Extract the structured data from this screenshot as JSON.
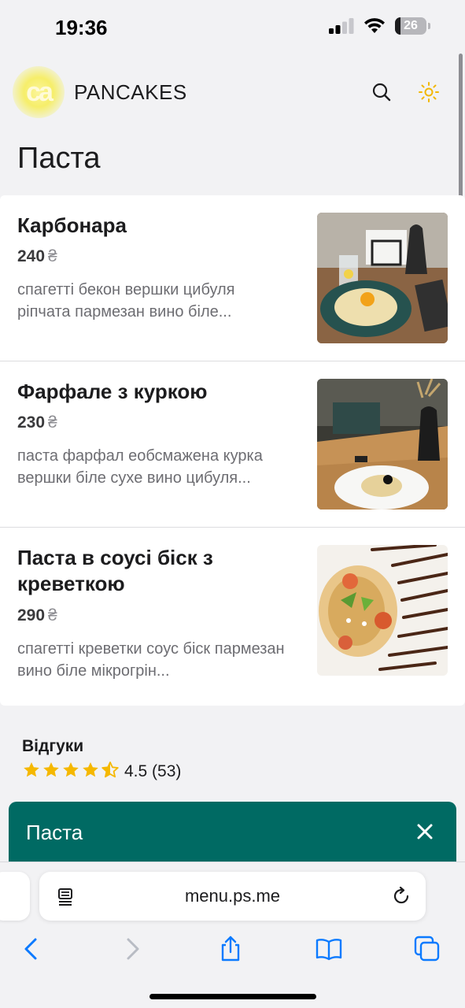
{
  "status_bar": {
    "time": "19:36",
    "battery_level": "26"
  },
  "header": {
    "logo_text": "ca",
    "brand_name": "PANCAKES",
    "search_icon": "search-icon",
    "theme_icon": "sun-icon",
    "accent_color": "#f2b705"
  },
  "page": {
    "title": "Паста"
  },
  "menu_items": [
    {
      "name": "Карбонара",
      "price": "240",
      "currency": "₴",
      "description": "спагетті бекон вершки цибуля ріпчата пармезан вино біле..."
    },
    {
      "name": "Фарфале з куркою",
      "price": "230",
      "currency": "₴",
      "description": "паста фарфал еобсмажена курка вершки біле сухе вино цибуля..."
    },
    {
      "name": "Паста в соусі біск з креветкою",
      "price": "290",
      "currency": "₴",
      "description": "спагетті креветки соус біск пармезан вино біле мікрогрін..."
    }
  ],
  "reviews": {
    "title": "Відгуки",
    "rating": 4.5,
    "rating_text": "4.5 (53)",
    "star_color": "#f5b800"
  },
  "category_bar": {
    "label": "Паста",
    "color": "#006a63",
    "close_icon": "close-icon"
  },
  "browser": {
    "url": "menu.ps.me",
    "toolbar": [
      "back-icon",
      "forward-icon",
      "share-icon",
      "bookmarks-icon",
      "tabs-icon"
    ],
    "tint_color": "#0a7aff"
  }
}
